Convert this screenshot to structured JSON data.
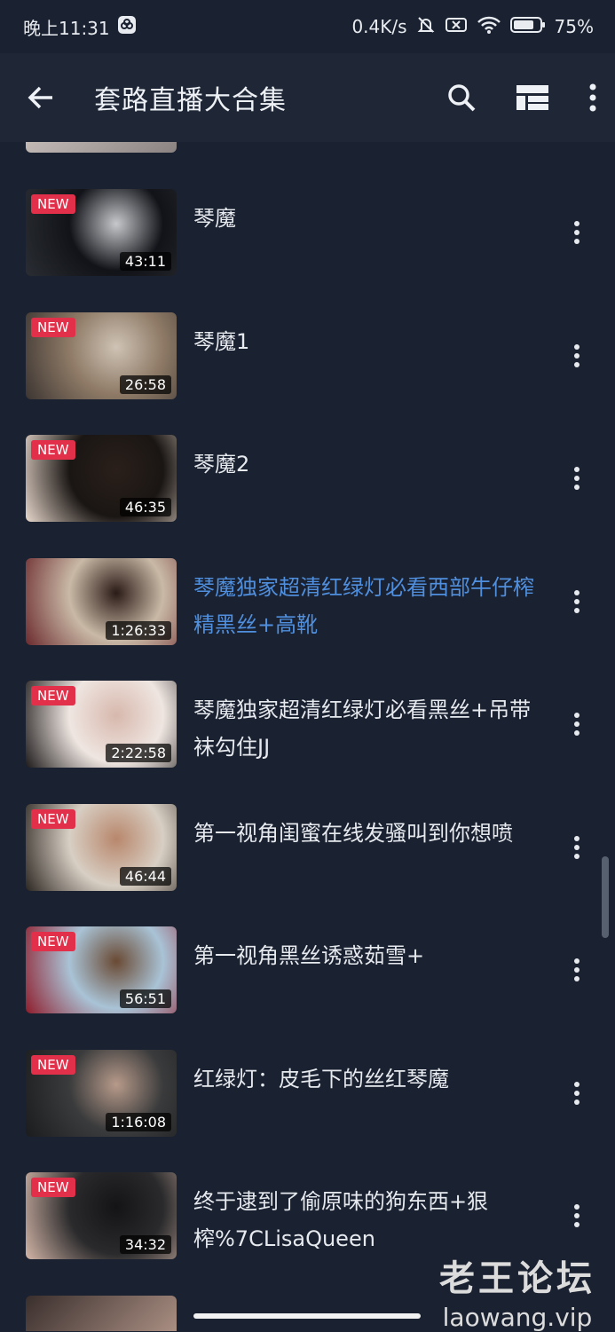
{
  "status_bar": {
    "time": "晚上11:31",
    "net_speed": "0.4K/s",
    "battery": "75%"
  },
  "app_bar": {
    "title": "套路直播大合集",
    "icons": [
      "back-arrow-icon",
      "search-icon",
      "layout-grid-icon",
      "more-vert-icon"
    ]
  },
  "badge_label": "NEW",
  "items": [
    {
      "title": "琴魔",
      "duration": "43:11",
      "new": true,
      "active": false,
      "thumb": [
        "#111318",
        "#2a2d33",
        "#c7c8cc"
      ]
    },
    {
      "title": "琴魔1",
      "duration": "26:58",
      "new": true,
      "active": false,
      "thumb": [
        "#8e7a66",
        "#3c3532",
        "#cfc3b5"
      ]
    },
    {
      "title": "琴魔2",
      "duration": "46:35",
      "new": true,
      "active": false,
      "thumb": [
        "#1a1614",
        "#e8d8cc",
        "#2a1f1a"
      ]
    },
    {
      "title": "琴魔独家超清红绿灯必看西部牛仔榨精黑丝+高靴",
      "duration": "1:26:33",
      "new": false,
      "active": true,
      "thumb": [
        "#c9b9a6",
        "#6b2a2e",
        "#2b1b17"
      ]
    },
    {
      "title": "琴魔独家超清红绿灯必看黑丝+吊带袜勾住JJ",
      "duration": "2:22:58",
      "new": true,
      "active": false,
      "thumb": [
        "#efe6e1",
        "#1d1a1a",
        "#d7b8ad"
      ]
    },
    {
      "title": "第一视角闺蜜在线发骚叫到你想喷",
      "duration": "46:44",
      "new": true,
      "active": false,
      "thumb": [
        "#d8cfc4",
        "#2c2621",
        "#b8876c"
      ]
    },
    {
      "title": "第一视角黑丝诱惑茹雪+",
      "duration": "56:51",
      "new": true,
      "active": false,
      "thumb": [
        "#a9c3d6",
        "#8e1c2b",
        "#6a4a34"
      ]
    },
    {
      "title": "红绿灯：皮毛下的丝红琴魔",
      "duration": "1:16:08",
      "new": true,
      "active": false,
      "thumb": [
        "#3a3b3c",
        "#1b1c1d",
        "#b79a8a"
      ]
    },
    {
      "title": "终于逮到了偷原味的狗东西+狠榨%7CLisaQueen",
      "duration": "34:32",
      "new": true,
      "active": false,
      "thumb": [
        "#2a2a2c",
        "#d4b6a8",
        "#141416"
      ]
    }
  ],
  "watermark": {
    "cn": "老王论坛",
    "en": "laowang.vip"
  }
}
